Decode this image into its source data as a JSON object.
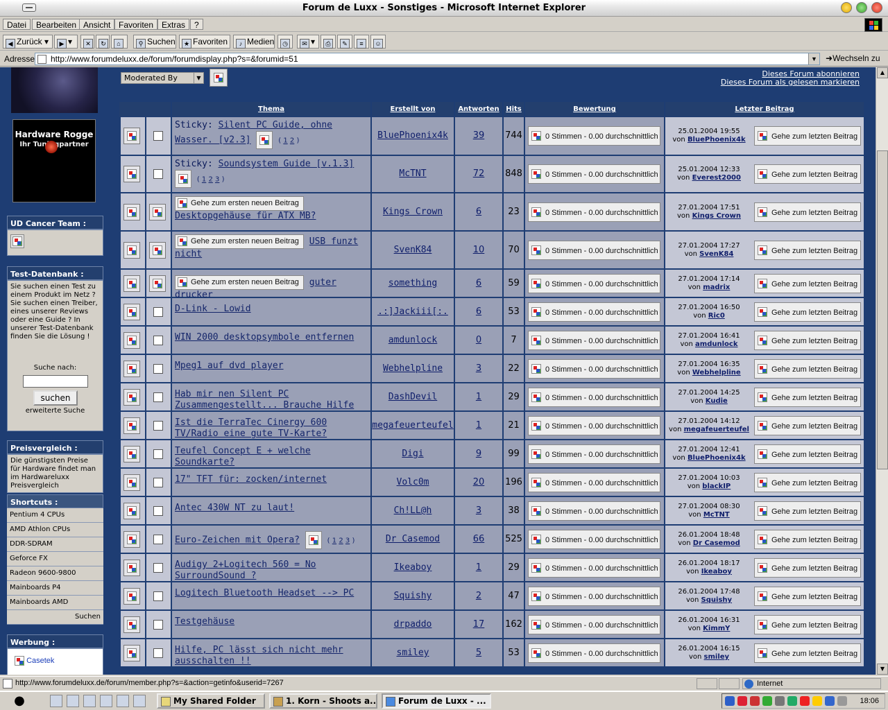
{
  "window": {
    "title": "Forum de Luxx - Sonstiges - Microsoft Internet Explorer"
  },
  "menubar": {
    "items": [
      "Datei",
      "Bearbeiten",
      "Ansicht",
      "Favoriten",
      "Extras",
      "?"
    ]
  },
  "toolbar": {
    "back": "Zurück",
    "search": "Suchen",
    "favorites": "Favoriten",
    "media": "Medien"
  },
  "address": {
    "label": "Adresse",
    "url": "http://www.forumdeluxx.de/forum/forumdisplay.php?s=&forumid=51",
    "go": "Wechseln zu"
  },
  "sidebar": {
    "banner_title": "Hardware Rogge",
    "banner_sub": "Ihr Tuningpartner",
    "cancer_team": "UD Cancer Team :",
    "testdb_title": "Test-Datenbank :",
    "testdb_text": "Sie suchen einen Test zu einem Produkt im Netz ? Sie suchen einen Treiber, eines unserer Reviews oder eine Guide ? In unserer Test-Datenbank finden Sie die Lösung !",
    "search_label": "Suche nach:",
    "search_button": "suchen",
    "advanced_search": "erweiterte Suche",
    "price_title": "Preisvergleich :",
    "price_text": "Die günstigsten Preise für Hardware findet man im Hardwareluxx Preisvergleich",
    "shortcuts_title": "Shortcuts :",
    "shortcuts": [
      "Pentium 4 CPUs",
      "AMD Athlon CPUs",
      "DDR-SDRAM",
      "Geforce FX",
      "Radeon 9600-9800",
      "Mainboards P4",
      "Mainboards AMD"
    ],
    "shortcuts_search": "Suchen",
    "ad_title": "Werbung :",
    "ad_link": "Casetek"
  },
  "forum": {
    "moderated_by": "Moderated By",
    "subscribe": "Dieses Forum abonnieren",
    "mark_read": "Dieses Forum als gelesen markieren",
    "columns": [
      "Thema",
      "Erstellt von",
      "Antworten",
      "Hits",
      "Bewertung",
      "Letzter Beitrag"
    ],
    "rating_text": "0 Stimmen - 0.00 durchschnittlich",
    "last_post_button": "Gehe zum letzten Beitrag",
    "first_new_button": "Gehe zum ersten neuen Beitrag",
    "by": "von"
  },
  "threads": [
    {
      "prefix": "Sticky: ",
      "title": "Silent PC Guide, ohne Wasser. [v2.3]",
      "pages": [
        "1",
        "2"
      ],
      "new": false,
      "author": "BluePhoenix4k",
      "replies": "39",
      "hits": "744",
      "date": "25.01.2004 19:55",
      "last_by": "BluePhoenix4k"
    },
    {
      "prefix": "Sticky: ",
      "title": "Soundsystem Guide [v.1.3]",
      "pages": [
        "1",
        "2",
        "3"
      ],
      "new": false,
      "author": "McTNT",
      "replies": "72",
      "hits": "848",
      "date": "25.01.2004 12:33",
      "last_by": "Everest2000"
    },
    {
      "prefix": "",
      "title": "Desktopgehäuse für ATX MB?",
      "pages": [],
      "new": true,
      "author": "Kings Crown",
      "replies": "6",
      "hits": "23",
      "date": "27.01.2004 17:51",
      "last_by": "Kings Crown"
    },
    {
      "prefix": "",
      "title": "USB funzt nicht",
      "pages": [],
      "new": true,
      "author": "SvenK84",
      "replies": "10",
      "hits": "70",
      "date": "27.01.2004 17:27",
      "last_by": "SvenK84"
    },
    {
      "prefix": "",
      "title": "guter drucker",
      "pages": [],
      "new": true,
      "author": "something",
      "replies": "6",
      "hits": "59",
      "date": "27.01.2004 17:14",
      "last_by": "madrix"
    },
    {
      "prefix": "",
      "title": "D-Link - Lowid",
      "pages": [],
      "new": false,
      "author": ".:]Jackiii[:.",
      "replies": "6",
      "hits": "53",
      "date": "27.01.2004 16:50",
      "last_by": "Ric0"
    },
    {
      "prefix": "",
      "title": "WIN 2000 desktopsymbole entfernen",
      "pages": [],
      "new": false,
      "author": "amdunlock",
      "replies": "0",
      "hits": "7",
      "date": "27.01.2004 16:41",
      "last_by": "amdunlock"
    },
    {
      "prefix": "",
      "title": "Mpeg1 auf dvd player",
      "pages": [],
      "new": false,
      "author": "Webhelpline",
      "replies": "3",
      "hits": "22",
      "date": "27.01.2004 16:35",
      "last_by": "Webhelpline"
    },
    {
      "prefix": "",
      "title": "Hab mir nen Silent PC Zusammengestellt... Brauche Hilfe :)",
      "pages": [],
      "new": false,
      "author": "DashDevil",
      "replies": "1",
      "hits": "29",
      "date": "27.01.2004 14:25",
      "last_by": "Kudie"
    },
    {
      "prefix": "",
      "title": "Ist die TerraTec Cinergy 600 TV/Radio eine gute TV-Karte?",
      "pages": [],
      "new": false,
      "author": "megafeuerteufel",
      "replies": "1",
      "hits": "21",
      "date": "27.01.2004 14:12",
      "last_by": "megafeuerteufel"
    },
    {
      "prefix": "",
      "title": "Teufel Concept E + welche Soundkarte?",
      "pages": [],
      "new": false,
      "author": "Digi",
      "replies": "9",
      "hits": "99",
      "date": "27.01.2004 12:41",
      "last_by": "BluePhoenix4k"
    },
    {
      "prefix": "",
      "title": "17\" TFT für: zocken/internet",
      "pages": [],
      "new": false,
      "author": "Volc0m",
      "replies": "20",
      "hits": "196",
      "date": "27.01.2004 10:03",
      "last_by": "blackIP"
    },
    {
      "prefix": "",
      "title": "Antec 430W NT zu laut!",
      "pages": [],
      "new": false,
      "author": "Ch!LL@h",
      "replies": "3",
      "hits": "38",
      "date": "27.01.2004 08:30",
      "last_by": "McTNT"
    },
    {
      "prefix": "",
      "title": "Euro-Zeichen mit Opera?",
      "pages": [
        "1",
        "2",
        "3"
      ],
      "new": false,
      "author": "Dr Casemod",
      "replies": "66",
      "hits": "525",
      "date": "26.01.2004 18:48",
      "last_by": "Dr Casemod"
    },
    {
      "prefix": "",
      "title": "Audigy 2+Logitech 560 = No SurroundSound ?",
      "pages": [],
      "new": false,
      "author": "Ikeaboy",
      "replies": "1",
      "hits": "29",
      "date": "26.01.2004 18:17",
      "last_by": "Ikeaboy"
    },
    {
      "prefix": "",
      "title": "Logitech Bluetooth Headset --> PC",
      "pages": [],
      "new": false,
      "author": "Squishy",
      "replies": "2",
      "hits": "47",
      "date": "26.01.2004 17:48",
      "last_by": "Squishy"
    },
    {
      "prefix": "",
      "title": "Testgehäuse",
      "pages": [],
      "new": false,
      "author": "drpaddo",
      "replies": "17",
      "hits": "162",
      "date": "26.01.2004 16:31",
      "last_by": "KimmY"
    },
    {
      "prefix": "",
      "title": "Hilfe, PC lässt sich nicht mehr ausschalten !!",
      "pages": [],
      "new": false,
      "author": "smiley",
      "replies": "5",
      "hits": "53",
      "date": "26.01.2004 16:15",
      "last_by": "smiley"
    }
  ],
  "statusbar": {
    "text": "http://www.forumdeluxx.de/forum/member.php?s=&action=getinfo&userid=7267",
    "zone": "Internet"
  },
  "taskbar": {
    "tasks": [
      "My Shared Folder",
      "1. Korn - Shoots a...",
      "Forum de Luxx - ..."
    ],
    "clock": "18:06"
  }
}
